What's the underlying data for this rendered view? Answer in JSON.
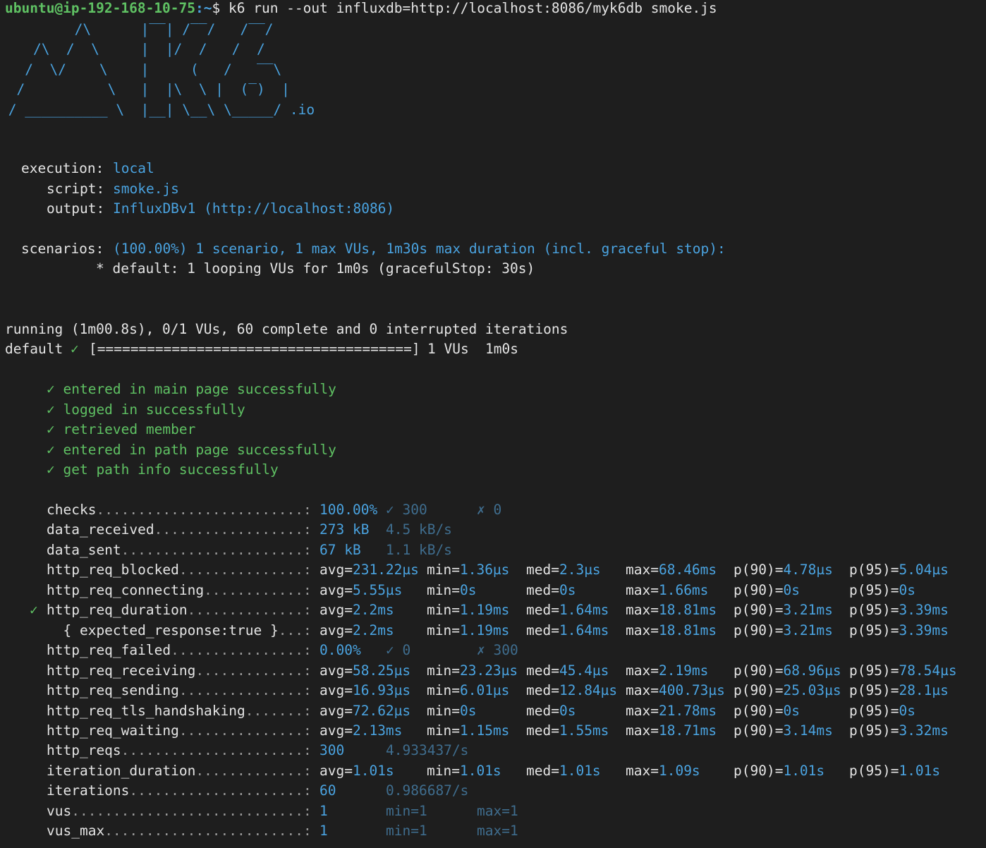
{
  "prompt": {
    "user_host": "ubuntu@ip-192-168-10-75",
    "path": ":~",
    "symbol": "$",
    "command": " k6 run --out influxdb=http://localhost:8086/myk6db smoke.js"
  },
  "logo": {
    "art": "         /\\      |‾‾| /‾‾/   /‾‾/\n    /\\  /  \\     |  |/  /   /  /\n   /  \\/    \\    |     (   /   ‾‾\\\n  /          \\   |  |\\  \\ |  (‾)  |\n / __________ \\  |__| \\__\\ \\_____/",
    "suffix": ".io"
  },
  "options": [
    {
      "label": "execution:",
      "value": "local"
    },
    {
      "label": "script:",
      "value": "smoke.js"
    },
    {
      "label": "output:",
      "value": "InfluxDBv1 (http://localhost:8086)"
    }
  ],
  "scenarios": {
    "label": "scenarios:",
    "summary": "(100.00%) 1 scenario, 1 max VUs, 1m30s max duration (incl. graceful stop):",
    "detail": "* default: 1 looping VUs for 1m0s (gracefulStop: 30s)"
  },
  "progress": {
    "running": "running (1m00.8s), 0/1 VUs, 60 complete and 0 interrupted iterations",
    "scenario": "default",
    "check": "✓",
    "bar": "[======================================]",
    "vus": "1 VUs",
    "time": "1m0s"
  },
  "checks": [
    "✓ entered in main page successfully",
    "✓ logged in successfully",
    "✓ retrieved member",
    "✓ entered in path page successfully",
    "✓ get path info successfully"
  ],
  "metrics": [
    {
      "check": "",
      "name": "checks",
      "dots": ".........................:",
      "vals": [
        {
          "t": "100.00%",
          "s": "blue"
        },
        {
          "t": "✓ 300",
          "s": "dim"
        },
        {
          "t": "✗ 0",
          "s": "dim"
        }
      ]
    },
    {
      "check": "",
      "name": "data_received",
      "dots": "..................:",
      "vals": [
        {
          "t": "273 kB",
          "s": "blue"
        },
        {
          "t": "4.5 kB/s",
          "s": "dim"
        }
      ]
    },
    {
      "check": "",
      "name": "data_sent",
      "dots": "......................:",
      "vals": [
        {
          "t": "67 kB",
          "s": "blue"
        },
        {
          "t": "1.1 kB/s",
          "s": "dim"
        }
      ]
    },
    {
      "check": "",
      "name": "http_req_blocked",
      "dots": "...............:",
      "vals": [
        {
          "k": "avg=",
          "v": "231.22µs"
        },
        {
          "k": "min=",
          "v": "1.36µs"
        },
        {
          "k": "med=",
          "v": "2.3µs"
        },
        {
          "k": "max=",
          "v": "68.46ms"
        },
        {
          "k": "p(90)=",
          "v": "4.78µs"
        },
        {
          "k": "p(95)=",
          "v": "5.04µs"
        }
      ]
    },
    {
      "check": "",
      "name": "http_req_connecting",
      "dots": "............:",
      "vals": [
        {
          "k": "avg=",
          "v": "5.55µs"
        },
        {
          "k": "min=",
          "v": "0s"
        },
        {
          "k": "med=",
          "v": "0s"
        },
        {
          "k": "max=",
          "v": "1.66ms"
        },
        {
          "k": "p(90)=",
          "v": "0s"
        },
        {
          "k": "p(95)=",
          "v": "0s"
        }
      ]
    },
    {
      "check": "✓",
      "name": "http_req_duration",
      "dots": "..............:",
      "vals": [
        {
          "k": "avg=",
          "v": "2.2ms"
        },
        {
          "k": "min=",
          "v": "1.19ms"
        },
        {
          "k": "med=",
          "v": "1.64ms"
        },
        {
          "k": "max=",
          "v": "18.81ms"
        },
        {
          "k": "p(90)=",
          "v": "3.21ms"
        },
        {
          "k": "p(95)=",
          "v": "3.39ms"
        }
      ]
    },
    {
      "check": "",
      "name": "  { expected_response:true }",
      "dots": "...:",
      "vals": [
        {
          "k": "avg=",
          "v": "2.2ms"
        },
        {
          "k": "min=",
          "v": "1.19ms"
        },
        {
          "k": "med=",
          "v": "1.64ms"
        },
        {
          "k": "max=",
          "v": "18.81ms"
        },
        {
          "k": "p(90)=",
          "v": "3.21ms"
        },
        {
          "k": "p(95)=",
          "v": "3.39ms"
        }
      ]
    },
    {
      "check": "",
      "name": "http_req_failed",
      "dots": "................:",
      "vals": [
        {
          "t": "0.00%",
          "s": "blue"
        },
        {
          "t": "✓ 0",
          "s": "dim"
        },
        {
          "t": "✗ 300",
          "s": "dim"
        }
      ]
    },
    {
      "check": "",
      "name": "http_req_receiving",
      "dots": ".............:",
      "vals": [
        {
          "k": "avg=",
          "v": "58.25µs"
        },
        {
          "k": "min=",
          "v": "23.23µs"
        },
        {
          "k": "med=",
          "v": "45.4µs"
        },
        {
          "k": "max=",
          "v": "2.19ms"
        },
        {
          "k": "p(90)=",
          "v": "68.96µs"
        },
        {
          "k": "p(95)=",
          "v": "78.54µs"
        }
      ]
    },
    {
      "check": "",
      "name": "http_req_sending",
      "dots": "...............:",
      "vals": [
        {
          "k": "avg=",
          "v": "16.93µs"
        },
        {
          "k": "min=",
          "v": "6.01µs"
        },
        {
          "k": "med=",
          "v": "12.84µs"
        },
        {
          "k": "max=",
          "v": "400.73µs"
        },
        {
          "k": "p(90)=",
          "v": "25.03µs"
        },
        {
          "k": "p(95)=",
          "v": "28.1µs"
        }
      ]
    },
    {
      "check": "",
      "name": "http_req_tls_handshaking",
      "dots": ".......:",
      "vals": [
        {
          "k": "avg=",
          "v": "72.62µs"
        },
        {
          "k": "min=",
          "v": "0s"
        },
        {
          "k": "med=",
          "v": "0s"
        },
        {
          "k": "max=",
          "v": "21.78ms"
        },
        {
          "k": "p(90)=",
          "v": "0s"
        },
        {
          "k": "p(95)=",
          "v": "0s"
        }
      ]
    },
    {
      "check": "",
      "name": "http_req_waiting",
      "dots": "...............:",
      "vals": [
        {
          "k": "avg=",
          "v": "2.13ms"
        },
        {
          "k": "min=",
          "v": "1.15ms"
        },
        {
          "k": "med=",
          "v": "1.55ms"
        },
        {
          "k": "max=",
          "v": "18.71ms"
        },
        {
          "k": "p(90)=",
          "v": "3.14ms"
        },
        {
          "k": "p(95)=",
          "v": "3.32ms"
        }
      ]
    },
    {
      "check": "",
      "name": "http_reqs",
      "dots": "......................:",
      "vals": [
        {
          "t": "300",
          "s": "blue"
        },
        {
          "t": "4.933437/s",
          "s": "dim"
        }
      ]
    },
    {
      "check": "",
      "name": "iteration_duration",
      "dots": ".............:",
      "vals": [
        {
          "k": "avg=",
          "v": "1.01s"
        },
        {
          "k": "min=",
          "v": "1.01s"
        },
        {
          "k": "med=",
          "v": "1.01s"
        },
        {
          "k": "max=",
          "v": "1.09s"
        },
        {
          "k": "p(90)=",
          "v": "1.01s"
        },
        {
          "k": "p(95)=",
          "v": "1.01s"
        }
      ]
    },
    {
      "check": "",
      "name": "iterations",
      "dots": ".....................:",
      "vals": [
        {
          "t": "60",
          "s": "blue"
        },
        {
          "t": "0.986687/s",
          "s": "dim"
        }
      ]
    },
    {
      "check": "",
      "name": "vus",
      "dots": "............................:",
      "vals": [
        {
          "t": "1",
          "s": "blue"
        },
        {
          "t": "min=1",
          "s": "dim"
        },
        {
          "t": "max=1",
          "s": "dim"
        }
      ]
    },
    {
      "check": "",
      "name": "vus_max",
      "dots": "........................:",
      "vals": [
        {
          "t": "1",
          "s": "blue"
        },
        {
          "t": "min=1",
          "s": "dim"
        },
        {
          "t": "max=1",
          "s": "dim"
        }
      ]
    }
  ]
}
